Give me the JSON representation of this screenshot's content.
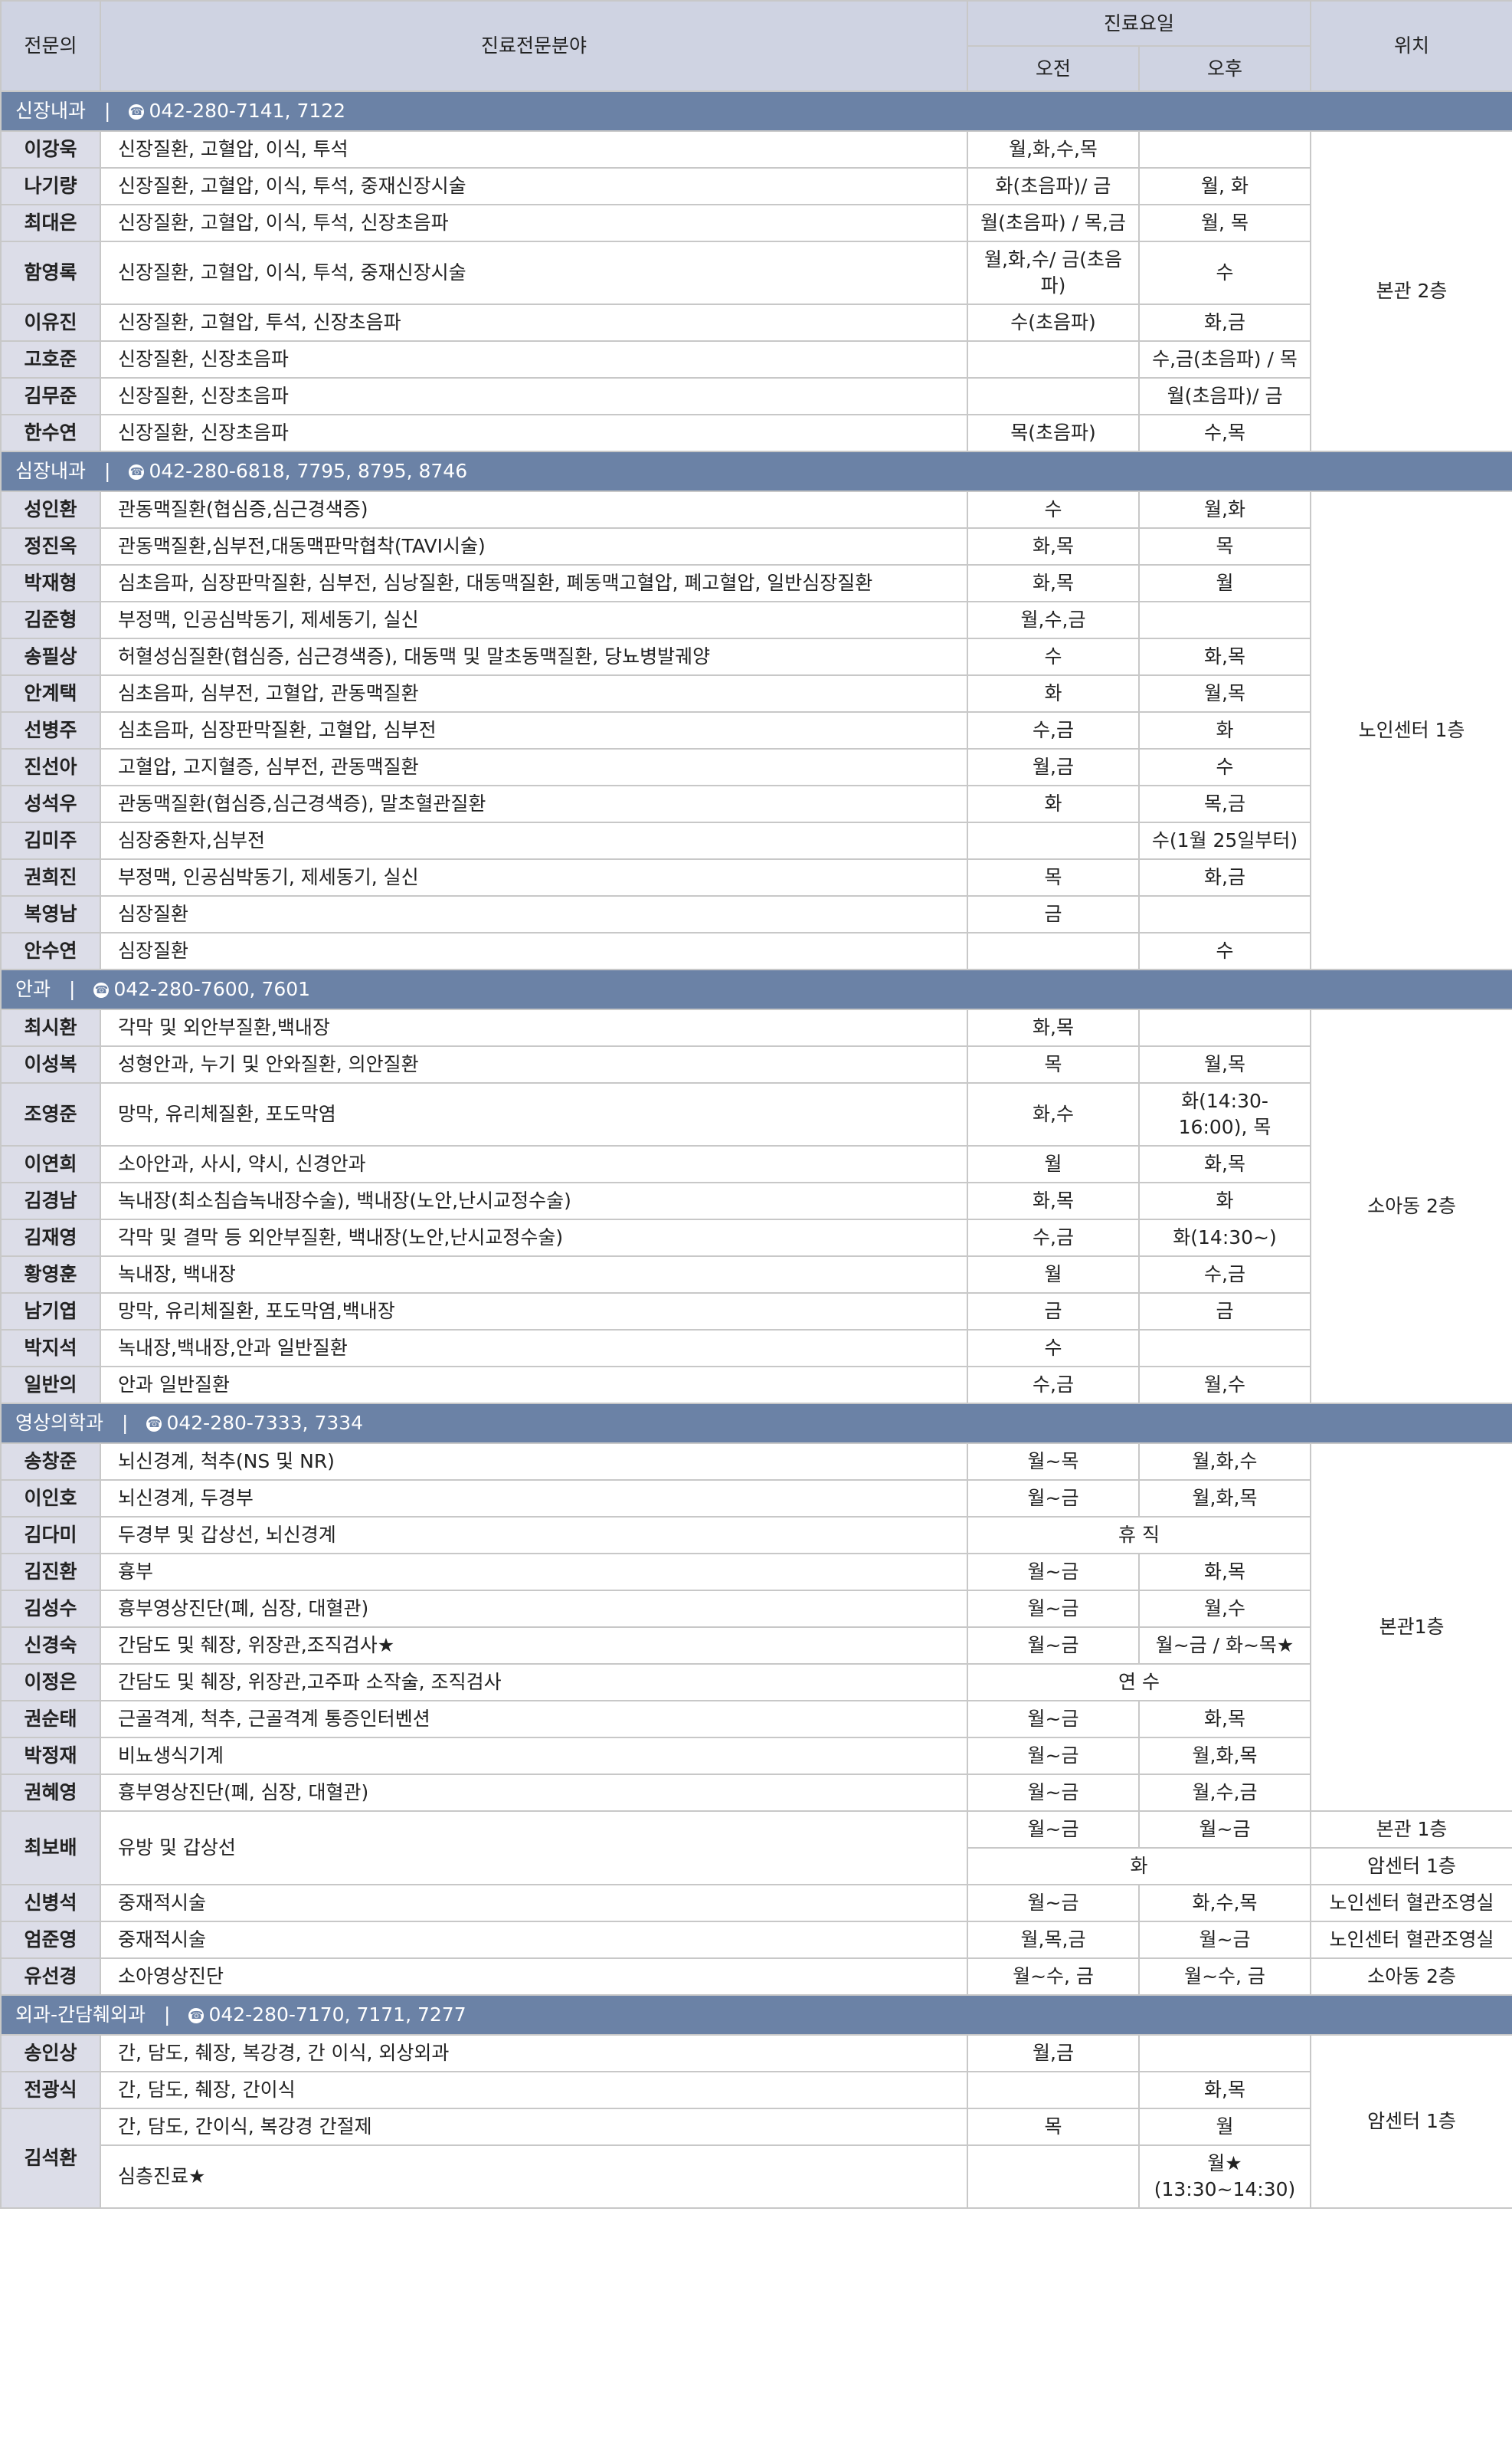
{
  "header": {
    "doctor": "전문의",
    "specialty": "진료전문분야",
    "days": "진료요일",
    "am": "오전",
    "pm": "오후",
    "location": "위치"
  },
  "sections": [
    {
      "name": "신장내과",
      "phone": "042-280-7141, 7122",
      "location": "본관 2층",
      "rows": [
        {
          "doctor": "이강욱",
          "specialty": "신장질환, 고혈압, 이식, 투석",
          "am": "월,화,수,목",
          "pm": ""
        },
        {
          "doctor": "나기량",
          "specialty": "신장질환, 고혈압, 이식, 투석, 중재신장시술",
          "am": "화(초음파)/ 금",
          "pm": "월, 화"
        },
        {
          "doctor": "최대은",
          "specialty": "신장질환, 고혈압, 이식, 투석, 신장초음파",
          "am": "월(초음파) / 목,금",
          "pm": "월, 목"
        },
        {
          "doctor": "함영록",
          "specialty": "신장질환, 고혈압, 이식, 투석, 중재신장시술",
          "am": "월,화,수/ 금(초음파)",
          "pm": "수"
        },
        {
          "doctor": "이유진",
          "specialty": "신장질환, 고혈압, 투석, 신장초음파",
          "am": "수(초음파)",
          "pm": "화,금"
        },
        {
          "doctor": "고호준",
          "specialty": "신장질환, 신장초음파",
          "am": "",
          "pm": "수,금(초음파) / 목"
        },
        {
          "doctor": "김무준",
          "specialty": "신장질환, 신장초음파",
          "am": "",
          "pm": "월(초음파)/ 금"
        },
        {
          "doctor": "한수연",
          "specialty": "신장질환, 신장초음파",
          "am": "목(초음파)",
          "pm": "수,목"
        }
      ]
    },
    {
      "name": "심장내과",
      "phone": "042-280-6818, 7795, 8795, 8746",
      "location": "노인센터 1층",
      "rows": [
        {
          "doctor": "성인환",
          "specialty": "관동맥질환(협심증,심근경색증)",
          "am": "수",
          "pm": "월,화"
        },
        {
          "doctor": "정진옥",
          "specialty": "관동맥질환,심부전,대동맥판막협착(TAVI시술)",
          "am": "화,목",
          "pm": "목"
        },
        {
          "doctor": "박재형",
          "specialty": "심초음파, 심장판막질환, 심부전, 심낭질환, 대동맥질환, 폐동맥고혈압, 폐고혈압, 일반심장질환",
          "am": "화,목",
          "pm": "월"
        },
        {
          "doctor": "김준형",
          "specialty": "부정맥, 인공심박동기, 제세동기, 실신",
          "am": "월,수,금",
          "pm": ""
        },
        {
          "doctor": "송필상",
          "specialty": "허혈성심질환(협심증, 심근경색증), 대동맥 및 말초동맥질환, 당뇨병발궤양",
          "am": "수",
          "pm": "화,목"
        },
        {
          "doctor": "안계택",
          "specialty": "심초음파, 심부전, 고혈압, 관동맥질환",
          "am": "화",
          "pm": "월,목"
        },
        {
          "doctor": "선병주",
          "specialty": "심초음파, 심장판막질환, 고혈압, 심부전",
          "am": "수,금",
          "pm": "화"
        },
        {
          "doctor": "진선아",
          "specialty": "고혈압, 고지혈증, 심부전, 관동맥질환",
          "am": "월,금",
          "pm": "수"
        },
        {
          "doctor": "성석우",
          "specialty": "관동맥질환(협심증,심근경색증), 말초혈관질환",
          "am": "화",
          "pm": "목,금"
        },
        {
          "doctor": "김미주",
          "specialty": "심장중환자,심부전",
          "am": "",
          "pm": "수(1월 25일부터)"
        },
        {
          "doctor": "권희진",
          "specialty": "부정맥, 인공심박동기, 제세동기, 실신",
          "am": "목",
          "pm": "화,금"
        },
        {
          "doctor": "복영남",
          "specialty": "심장질환",
          "am": "금",
          "pm": ""
        },
        {
          "doctor": "안수연",
          "specialty": "심장질환",
          "am": "",
          "pm": "수"
        }
      ]
    },
    {
      "name": "안과",
      "phone": "042-280-7600, 7601",
      "location": "소아동 2층",
      "rows": [
        {
          "doctor": "최시환",
          "specialty": "각막 및 외안부질환,백내장",
          "am": "화,목",
          "pm": ""
        },
        {
          "doctor": "이성복",
          "specialty": "성형안과, 누기 및 안와질환, 의안질환",
          "am": "목",
          "pm": "월,목"
        },
        {
          "doctor": "조영준",
          "specialty": "망막, 유리체질환, 포도막염",
          "am": "화,수",
          "pm": "화(14:30-16:00), 목"
        },
        {
          "doctor": "이연희",
          "specialty": "소아안과, 사시, 약시, 신경안과",
          "am": "월",
          "pm": "화,목"
        },
        {
          "doctor": "김경남",
          "specialty": "녹내장(최소침습녹내장수술), 백내장(노안,난시교정수술)",
          "am": "화,목",
          "pm": "화"
        },
        {
          "doctor": "김재영",
          "specialty": "각막 및 결막 등 외안부질환, 백내장(노안,난시교정수술)",
          "am": "수,금",
          "pm": "화(14:30~)"
        },
        {
          "doctor": "황영훈",
          "specialty": "녹내장, 백내장",
          "am": "월",
          "pm": "수,금"
        },
        {
          "doctor": "남기엽",
          "specialty": "망막, 유리체질환, 포도막염,백내장",
          "am": "금",
          "pm": "금"
        },
        {
          "doctor": "박지석",
          "specialty": "녹내장,백내장,안과 일반질환",
          "am": "수",
          "pm": ""
        },
        {
          "doctor": "일반의",
          "specialty": "안과 일반질환",
          "am": "수,금",
          "pm": "월,수"
        }
      ]
    },
    {
      "name": "영상의학과",
      "phone": "042-280-7333, 7334",
      "location": "본관1층",
      "rows": [
        {
          "doctor": "송창준",
          "specialty": "뇌신경계, 척추(NS 및 NR)",
          "am": "월~목",
          "pm": "월,화,수"
        },
        {
          "doctor": "이인호",
          "specialty": "뇌신경계, 두경부",
          "am": "월~금",
          "pm": "월,화,목"
        },
        {
          "doctor": "김다미",
          "specialty": "두경부 및 갑상선, 뇌신경계",
          "merged": "휴 직"
        },
        {
          "doctor": "김진환",
          "specialty": "흉부",
          "am": "월~금",
          "pm": "화,목"
        },
        {
          "doctor": "김성수",
          "specialty": "흉부영상진단(폐, 심장, 대혈관)",
          "am": "월~금",
          "pm": "월,수"
        },
        {
          "doctor": "신경숙",
          "specialty": "간담도 및 췌장, 위장관,조직검사★",
          "am": "월~금",
          "pm": "월~금 / 화~목★"
        },
        {
          "doctor": "이정은",
          "specialty": "간담도 및 췌장, 위장관,고주파 소작술, 조직검사",
          "merged": "연 수"
        },
        {
          "doctor": "권순태",
          "specialty": "근골격계, 척추, 근골격계 통증인터벤션",
          "am": "월~금",
          "pm": "화,목"
        },
        {
          "doctor": "박정재",
          "specialty": "비뇨생식기계",
          "am": "월~금",
          "pm": "월,화,목"
        },
        {
          "doctor": "권혜영",
          "specialty": "흉부영상진단(폐, 심장, 대혈관)",
          "am": "월~금",
          "pm": "월,수,금"
        }
      ],
      "extra": [
        {
          "doctor": "최보배",
          "specialty": "유방 및 갑상선",
          "am1": "월~금",
          "pm1": "월~금",
          "loc1": "본관 1층",
          "merged2": "화",
          "loc2": "암센터 1층"
        },
        {
          "doctor": "신병석",
          "specialty": "중재적시술",
          "am": "월~금",
          "pm": "화,수,목",
          "loc": "노인센터 혈관조영실"
        },
        {
          "doctor": "엄준영",
          "specialty": "중재적시술",
          "am": "월,목,금",
          "pm": "월~금",
          "loc": "노인센터 혈관조영실"
        },
        {
          "doctor": "유선경",
          "specialty": "소아영상진단",
          "am": "월~수, 금",
          "pm": "월~수, 금",
          "loc": "소아동 2층"
        }
      ]
    },
    {
      "name": "외과-간담췌외과",
      "phone": "042-280-7170, 7171, 7277",
      "location": "암센터 1층",
      "rows": [
        {
          "doctor": "송인상",
          "specialty": "간, 담도, 췌장, 복강경, 간 이식, 외상외과",
          "am": "월,금",
          "pm": ""
        },
        {
          "doctor": "전광식",
          "specialty": "간, 담도, 췌장, 간이식",
          "am": "",
          "pm": "화,목"
        }
      ],
      "last": {
        "doctor": "김석환",
        "specialty1": "간, 담도, 간이식, 복강경 간절제",
        "am1": "목",
        "pm1": "월",
        "specialty2": "심층진료★",
        "am2": "",
        "pm2": "월★ (13:30~14:30)"
      }
    }
  ]
}
